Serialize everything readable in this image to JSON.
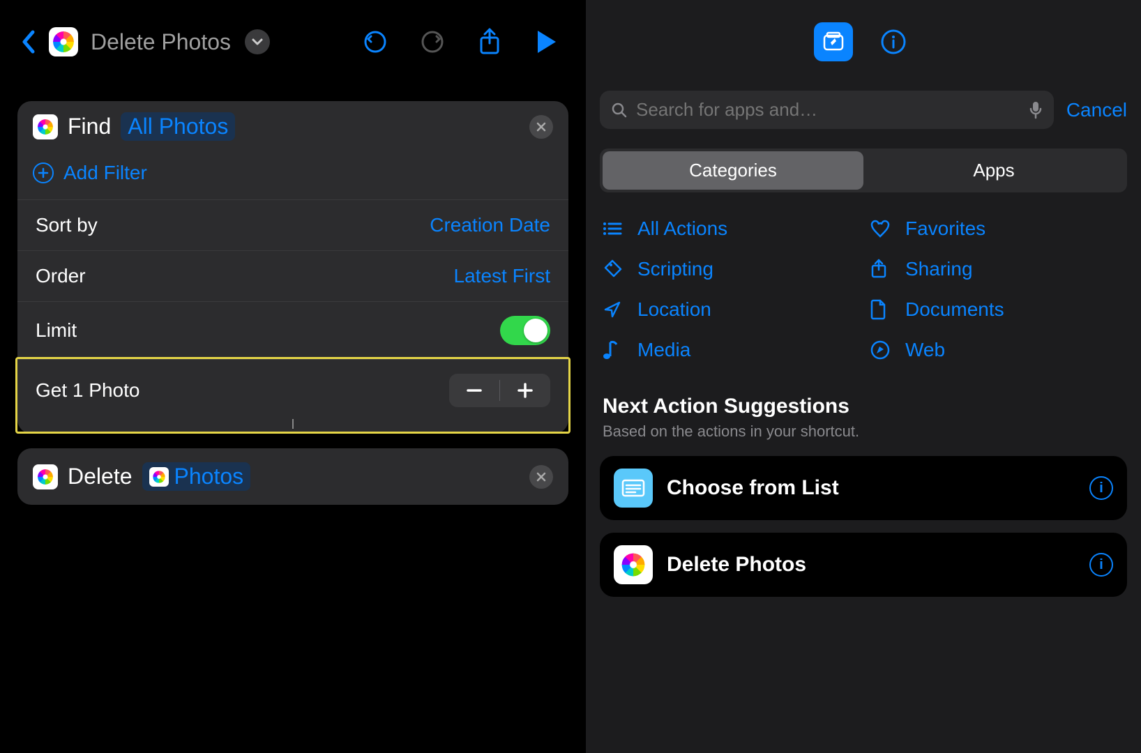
{
  "header": {
    "title": "Delete Photos"
  },
  "actions": {
    "find": {
      "label": "Find",
      "target": "All Photos",
      "add_filter": "Add Filter",
      "sort_by_label": "Sort by",
      "sort_by_value": "Creation Date",
      "order_label": "Order",
      "order_value": "Latest First",
      "limit_label": "Limit",
      "limit_enabled": true,
      "get_text": "Get 1 Photo"
    },
    "delete": {
      "label": "Delete",
      "target": "Photos"
    }
  },
  "right": {
    "search_placeholder": "Search for apps and…",
    "cancel": "Cancel",
    "segments": {
      "categories": "Categories",
      "apps": "Apps"
    },
    "categories": [
      {
        "icon": "list",
        "label": "All Actions"
      },
      {
        "icon": "heart",
        "label": "Favorites"
      },
      {
        "icon": "tag",
        "label": "Scripting"
      },
      {
        "icon": "share",
        "label": "Sharing"
      },
      {
        "icon": "location",
        "label": "Location"
      },
      {
        "icon": "doc",
        "label": "Documents"
      },
      {
        "icon": "music",
        "label": "Media"
      },
      {
        "icon": "compass",
        "label": "Web"
      }
    ],
    "suggestions_title": "Next Action Suggestions",
    "suggestions_sub": "Based on the actions in your shortcut.",
    "suggestions": [
      {
        "label": "Choose from List",
        "icon": "list-card"
      },
      {
        "label": "Delete Photos",
        "icon": "photos"
      }
    ]
  }
}
